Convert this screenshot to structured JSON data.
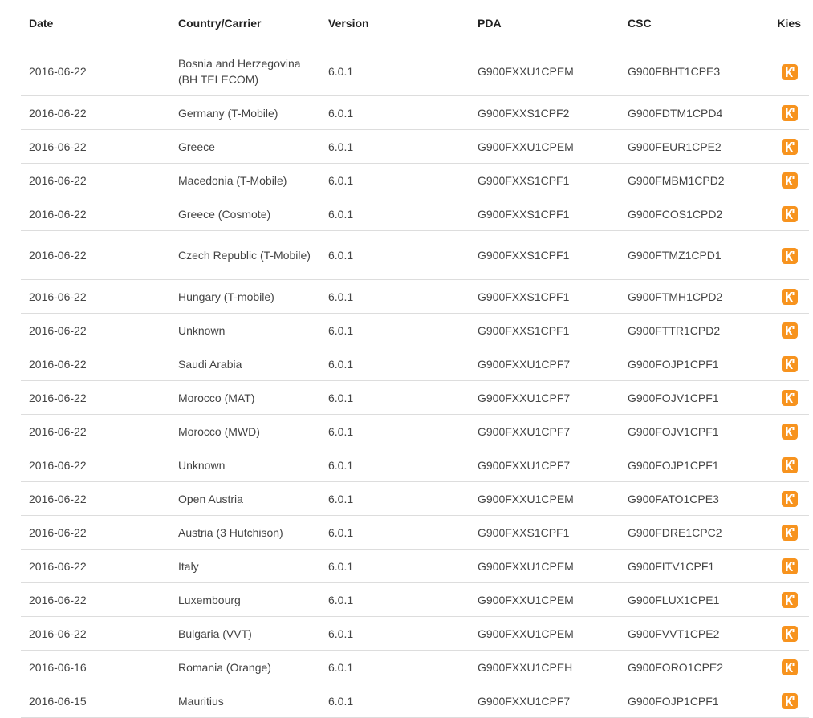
{
  "headers": {
    "date": "Date",
    "carrier": "Country/Carrier",
    "version": "Version",
    "pda": "PDA",
    "csc": "CSC",
    "kies": "Kies"
  },
  "kies_icon": "kies-download-icon",
  "accent_color": "#f7931e",
  "rows": [
    {
      "date": "2016-06-22",
      "carrier": "Bosnia and Herzegovina (BH TELECOM)",
      "version": "6.0.1",
      "pda": "G900FXXU1CPEM",
      "csc": "G900FBHT1CPE3"
    },
    {
      "date": "2016-06-22",
      "carrier": "Germany (T-Mobile)",
      "version": "6.0.1",
      "pda": "G900FXXS1CPF2",
      "csc": "G900FDTM1CPD4"
    },
    {
      "date": "2016-06-22",
      "carrier": "Greece",
      "version": "6.0.1",
      "pda": "G900FXXU1CPEM",
      "csc": "G900FEUR1CPE2"
    },
    {
      "date": "2016-06-22",
      "carrier": "Macedonia (T-Mobile)",
      "version": "6.0.1",
      "pda": "G900FXXS1CPF1",
      "csc": "G900FMBM1CPD2"
    },
    {
      "date": "2016-06-22",
      "carrier": "Greece (Cosmote)",
      "version": "6.0.1",
      "pda": "G900FXXS1CPF1",
      "csc": "G900FCOS1CPD2"
    },
    {
      "date": "2016-06-22",
      "carrier": "Czech Republic (T-Mobile)",
      "version": "6.0.1",
      "pda": "G900FXXS1CPF1",
      "csc": "G900FTMZ1CPD1"
    },
    {
      "date": "2016-06-22",
      "carrier": "Hungary (T-mobile)",
      "version": "6.0.1",
      "pda": "G900FXXS1CPF1",
      "csc": "G900FTMH1CPD2"
    },
    {
      "date": "2016-06-22",
      "carrier": "Unknown",
      "version": "6.0.1",
      "pda": "G900FXXS1CPF1",
      "csc": "G900FTTR1CPD2"
    },
    {
      "date": "2016-06-22",
      "carrier": "Saudi Arabia",
      "version": "6.0.1",
      "pda": "G900FXXU1CPF7",
      "csc": "G900FOJP1CPF1"
    },
    {
      "date": "2016-06-22",
      "carrier": "Morocco (MAT)",
      "version": "6.0.1",
      "pda": "G900FXXU1CPF7",
      "csc": "G900FOJV1CPF1"
    },
    {
      "date": "2016-06-22",
      "carrier": "Morocco (MWD)",
      "version": "6.0.1",
      "pda": "G900FXXU1CPF7",
      "csc": "G900FOJV1CPF1"
    },
    {
      "date": "2016-06-22",
      "carrier": "Unknown",
      "version": "6.0.1",
      "pda": "G900FXXU1CPF7",
      "csc": "G900FOJP1CPF1"
    },
    {
      "date": "2016-06-22",
      "carrier": "Open Austria",
      "version": "6.0.1",
      "pda": "G900FXXU1CPEM",
      "csc": "G900FATO1CPE3"
    },
    {
      "date": "2016-06-22",
      "carrier": "Austria (3 Hutchison)",
      "version": "6.0.1",
      "pda": "G900FXXS1CPF1",
      "csc": "G900FDRE1CPC2"
    },
    {
      "date": "2016-06-22",
      "carrier": "Italy",
      "version": "6.0.1",
      "pda": "G900FXXU1CPEM",
      "csc": "G900FITV1CPF1"
    },
    {
      "date": "2016-06-22",
      "carrier": "Luxembourg",
      "version": "6.0.1",
      "pda": "G900FXXU1CPEM",
      "csc": "G900FLUX1CPE1"
    },
    {
      "date": "2016-06-22",
      "carrier": "Bulgaria (VVT)",
      "version": "6.0.1",
      "pda": "G900FXXU1CPEM",
      "csc": "G900FVVT1CPE2"
    },
    {
      "date": "2016-06-16",
      "carrier": "Romania (Orange)",
      "version": "6.0.1",
      "pda": "G900FXXU1CPEH",
      "csc": "G900FORO1CPE2"
    },
    {
      "date": "2016-06-15",
      "carrier": "Mauritius",
      "version": "6.0.1",
      "pda": "G900FXXU1CPF7",
      "csc": "G900FOJP1CPF1"
    }
  ]
}
